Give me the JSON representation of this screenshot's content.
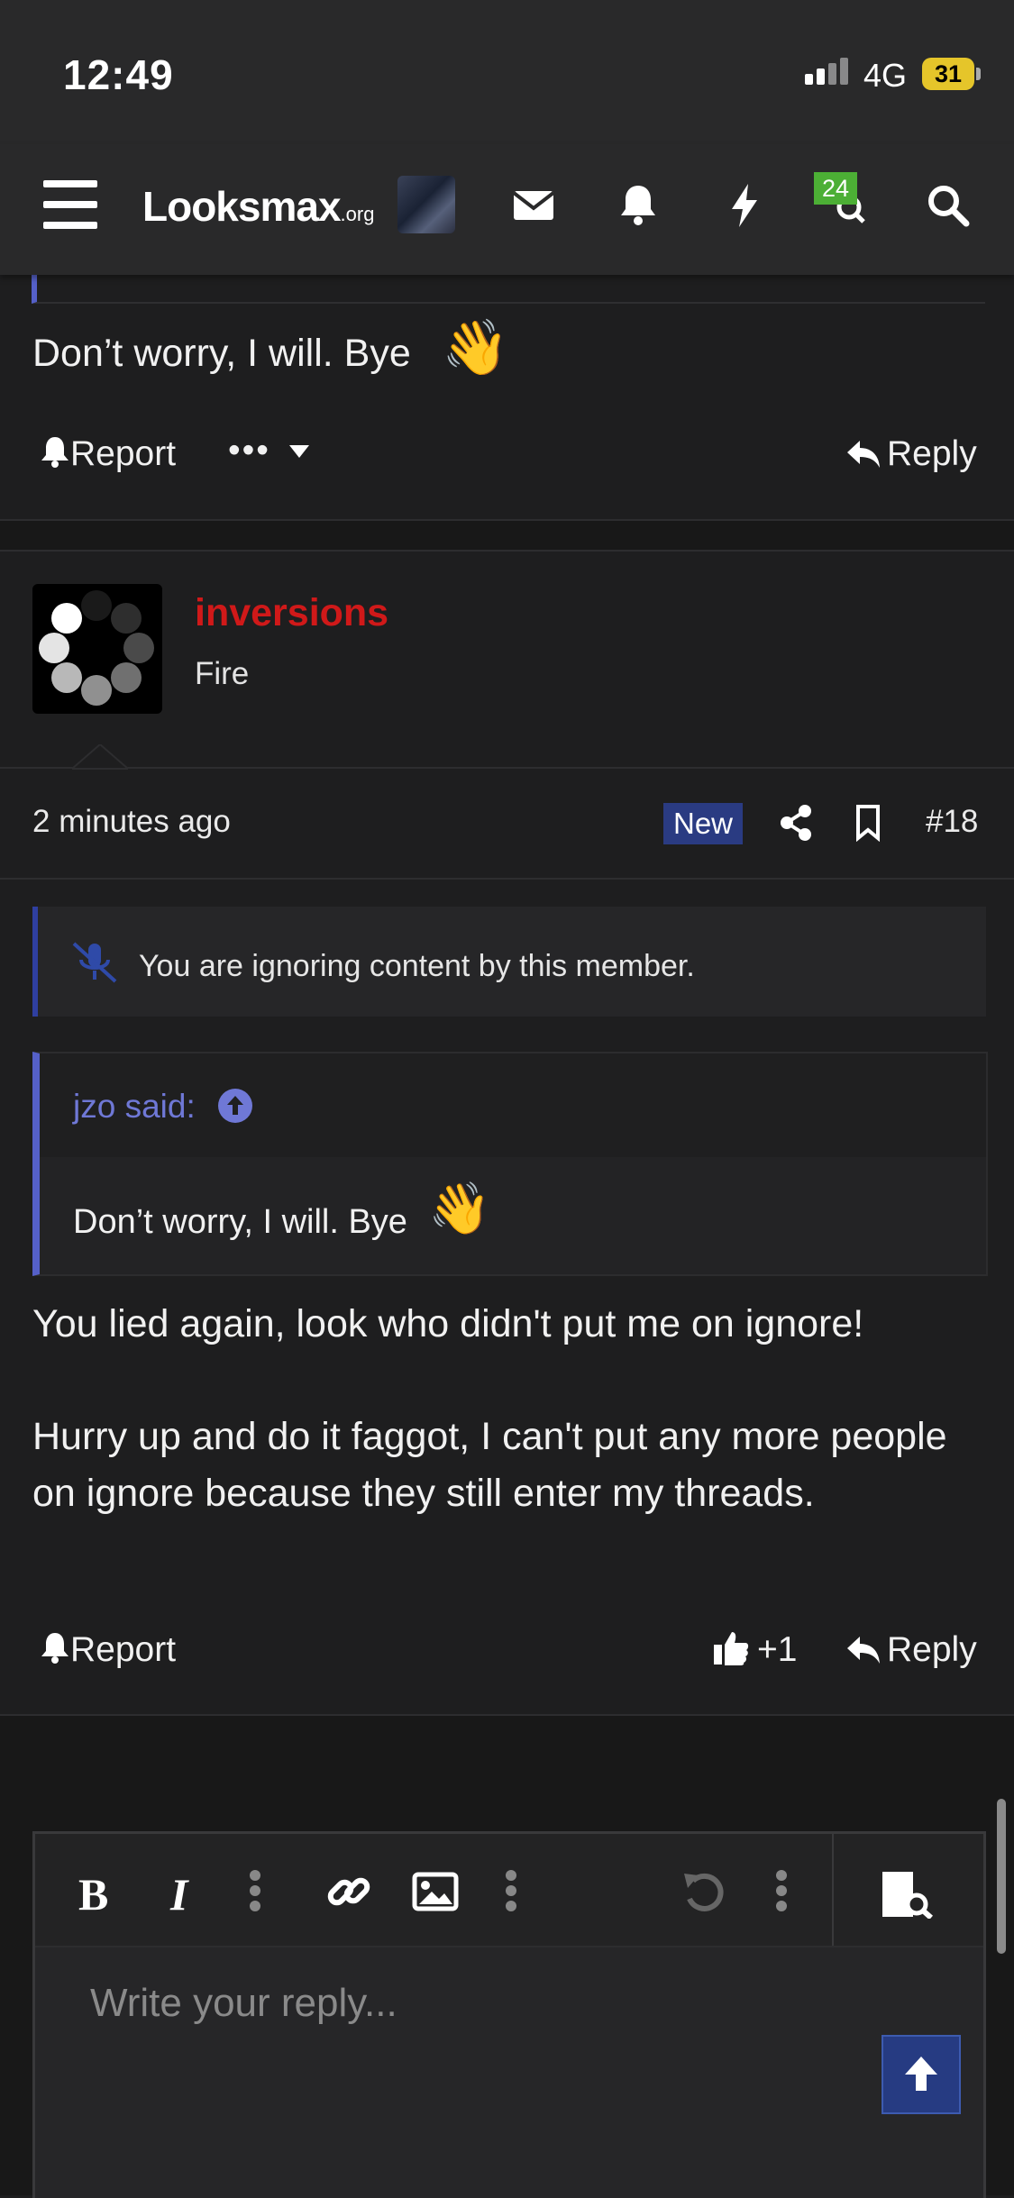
{
  "status_bar": {
    "time": "12:49",
    "network": "4G",
    "battery": "31"
  },
  "nav": {
    "logo_main": "Looksmax",
    "logo_suffix": ".org",
    "chat_badge": "24"
  },
  "prev_post": {
    "text": "Don’t worry, I will. Bye",
    "emoji": "👋",
    "report_label": "Report",
    "more_label": "•••",
    "reply_label": "Reply"
  },
  "post": {
    "username": "inversions",
    "user_title": "Fire",
    "timestamp": "2 minutes ago",
    "new_badge": "New",
    "post_number": "#18",
    "ignore_notice": "You are ignoring content by this member.",
    "quote": {
      "author_label": "jzo said:",
      "text": "Don’t worry, I will. Bye",
      "emoji": "👋"
    },
    "paragraph1": "You lied again, look who didn't put me on ignore!",
    "paragraph2": "Hurry up and do it faggot, I can't put any more people on ignore because they still enter my threads.",
    "report_label": "Report",
    "like_count": "+1",
    "reply_label": "Reply"
  },
  "editor": {
    "placeholder": "Write your reply..."
  },
  "colors": {
    "username": "#d01919",
    "accent_blue": "#2a3b82",
    "quote_border": "#5560c8",
    "badge_green": "#4caf35"
  }
}
